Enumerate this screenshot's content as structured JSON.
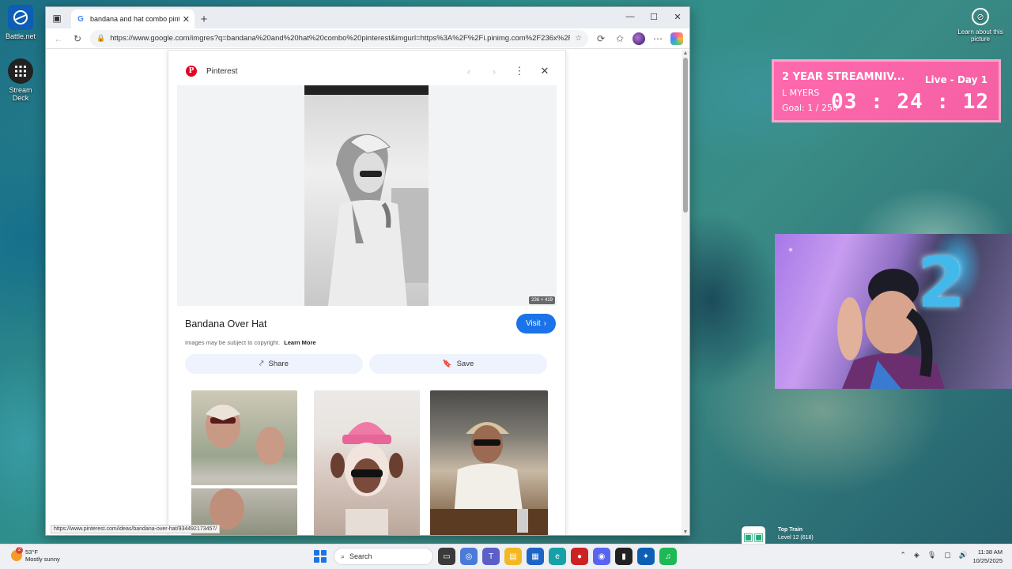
{
  "desktop": {
    "icons": [
      {
        "label": "Battle.net",
        "icon": "battlenet-icon"
      },
      {
        "label": "Stream Deck",
        "icon": "stream-deck-icon"
      }
    ],
    "learn_about": "Learn about this picture"
  },
  "browser": {
    "tab_title": "bandana and hat combo pinterest",
    "url": "https://www.google.com/imgres?q=bandana%20and%20hat%20combo%20pinterest&imgurl=https%3A%2F%2Fi.pinimg.com%2F236x%2F...",
    "status_url": "https://www.pinterest.com/ideas/bandana-over-hat/934492173457/"
  },
  "preview": {
    "site": "Pinterest",
    "dimensions": "236 × 419",
    "title": "Bandana Over Hat",
    "visit_label": "Visit",
    "copyright": "Images may be subject to copyright.",
    "learn_more": "Learn More",
    "share_label": "Share",
    "save_label": "Save"
  },
  "stream": {
    "subathon": {
      "title": "2 YEAR STREAMNIV...",
      "name": "L MYERS",
      "goal": "Goal: 1 / 250",
      "day": "Live - Day 1",
      "timer": "03 : 24 : 12"
    },
    "top_train": {
      "title": "Top Train",
      "level": "Level 12 (618)"
    }
  },
  "taskbar": {
    "temp": "53°F",
    "weather": "Mostly sunny",
    "weather_badge": "2",
    "search_placeholder": "Search",
    "time": "11:38 AM",
    "date": "10/25/2025"
  },
  "colors": {
    "visit_button": "#1a73e8",
    "subathon_bg": "#ff69ad",
    "pinterest_red": "#e60023"
  }
}
